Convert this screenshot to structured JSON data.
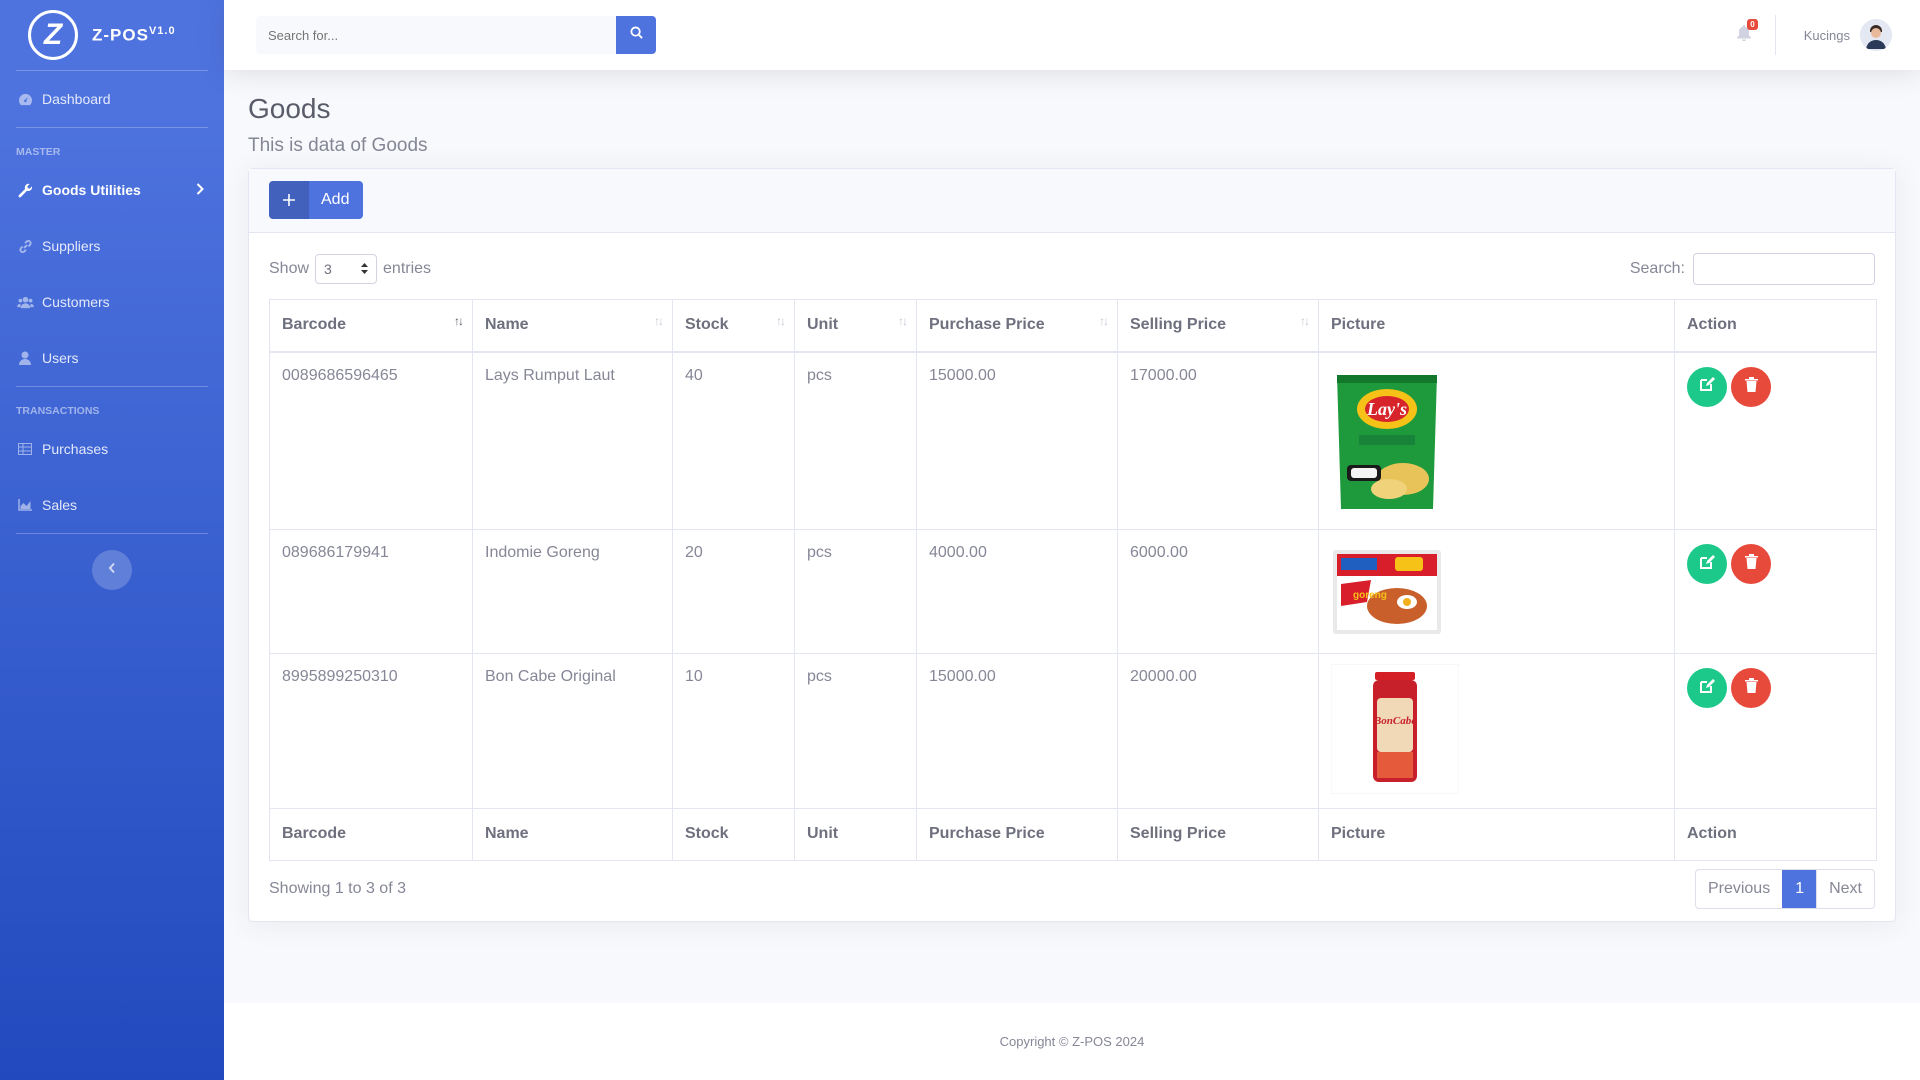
{
  "brand": {
    "logo_letter": "Z",
    "name": "Z-POS",
    "version": "V1.0"
  },
  "sidebar": {
    "dashboard": "Dashboard",
    "heading_master": "MASTER",
    "items_master": [
      "Goods Utilities",
      "Suppliers",
      "Customers",
      "Users"
    ],
    "heading_transactions": "TRANSACTIONS",
    "items_transactions": [
      "Purchases",
      "Sales"
    ],
    "toggle_icon": "chevron-left-icon"
  },
  "topbar": {
    "search_placeholder": "Search for...",
    "notification_count": "0",
    "username": "Kucings"
  },
  "page": {
    "title": "Goods",
    "subtitle": "This is data of Goods"
  },
  "card": {
    "add_label": "Add"
  },
  "datatable": {
    "show_label": "Show",
    "length_value": "3",
    "entries_label": "entries",
    "search_label": "Search:",
    "columns": [
      "Barcode",
      "Name",
      "Stock",
      "Unit",
      "Purchase Price",
      "Selling Price",
      "Picture",
      "Action"
    ],
    "rows": [
      {
        "barcode": "0089686596465",
        "name": "Lays Rumput Laut",
        "stock": "40",
        "unit": "pcs",
        "purchase": "15000.00",
        "selling": "17000.00",
        "picture": "lays-chips-image"
      },
      {
        "barcode": "089686179941",
        "name": "Indomie Goreng",
        "stock": "20",
        "unit": "pcs",
        "purchase": "4000.00",
        "selling": "6000.00",
        "picture": "indomie-image"
      },
      {
        "barcode": "8995899250310",
        "name": "Bon Cabe Original",
        "stock": "10",
        "unit": "pcs",
        "purchase": "15000.00",
        "selling": "20000.00",
        "picture": "boncabe-image"
      }
    ],
    "info": "Showing 1 to 3 of 3",
    "pager": {
      "previous": "Previous",
      "current": "1",
      "next": "Next"
    }
  },
  "footer": {
    "copyright": "Copyright © Z-POS 2024"
  },
  "colors": {
    "primary": "#4e73df",
    "success": "#1cc88a",
    "danger": "#e74a3b"
  }
}
